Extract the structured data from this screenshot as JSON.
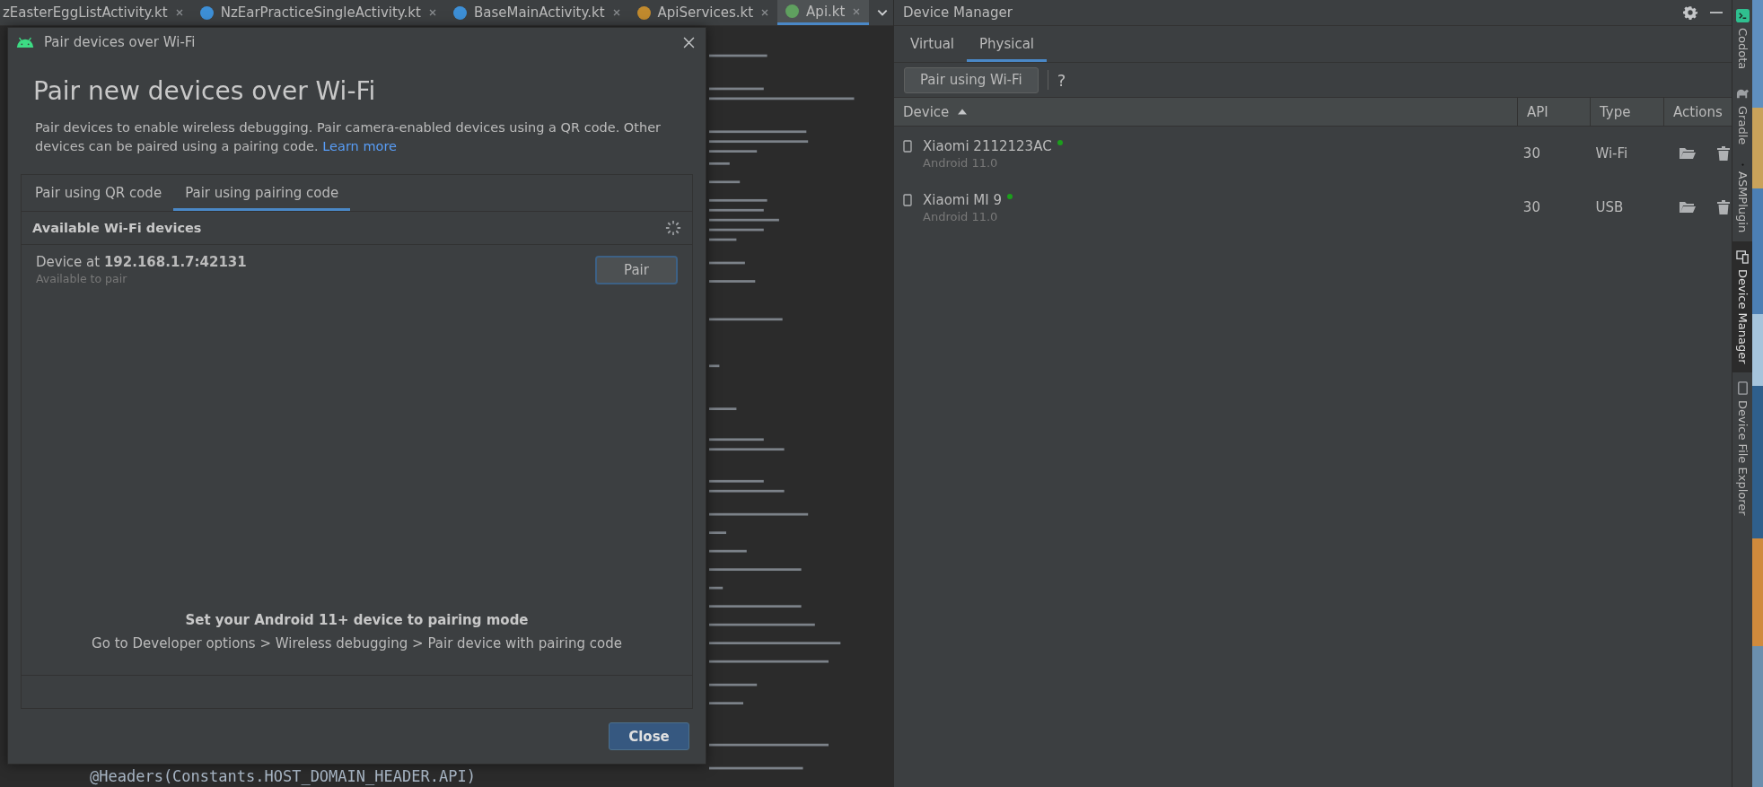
{
  "editor_tabs": [
    {
      "label": "zEasterEggListActivity.kt",
      "selected": false
    },
    {
      "label": "NzEarPracticeSingleActivity.kt",
      "selected": false
    },
    {
      "label": "BaseMainActivity.kt",
      "selected": false
    },
    {
      "label": "ApiServices.kt",
      "selected": false
    },
    {
      "label": "Api.kt",
      "selected": true
    }
  ],
  "code_line": "@Headers(Constants.HOST_DOMAIN_HEADER.API)",
  "dialog": {
    "title": "Pair devices over Wi-Fi",
    "heading": "Pair new devices over Wi-Fi",
    "description": "Pair devices to enable wireless debugging. Pair camera-enabled devices using a QR code. Other devices can be paired using a pairing code.",
    "link": "Learn more",
    "tabs": [
      {
        "label": "Pair using QR code",
        "selected": false
      },
      {
        "label": "Pair using pairing code",
        "selected": true
      }
    ],
    "section_title": "Available Wi-Fi devices",
    "devices": [
      {
        "name": "Device at **192.168.1.7:42131**",
        "status": "Available to pair",
        "button": "Pair"
      }
    ],
    "instruction_title": "Set your Android 11+ device to pairing mode",
    "instruction": "Go to Developer options > Wireless debugging > Pair device with pairing code",
    "close_button": "Close"
  },
  "device_manager": {
    "title": "Device Manager",
    "tabs": [
      {
        "label": "Virtual",
        "selected": false
      },
      {
        "label": "Physical",
        "selected": true
      }
    ],
    "pair_button": "Pair using Wi-Fi",
    "help": "?",
    "columns": [
      "Device",
      "API",
      "Type",
      "Actions"
    ],
    "rows": [
      {
        "name": "Xiaomi 2112123AC",
        "online": true,
        "android": "Android 11.0",
        "api": "30",
        "type": "Wi-Fi"
      },
      {
        "name": "Xiaomi MI 9",
        "online": true,
        "android": "Android 11.0",
        "api": "30",
        "type": "USB"
      }
    ]
  },
  "side_tools": [
    {
      "label": "Codota",
      "selected": false
    },
    {
      "label": "Gradle",
      "selected": false
    },
    {
      "label": "ASMPlugin",
      "selected": false
    },
    {
      "label": "Device Manager",
      "selected": true
    },
    {
      "label": "Device File Explorer",
      "selected": false
    }
  ]
}
